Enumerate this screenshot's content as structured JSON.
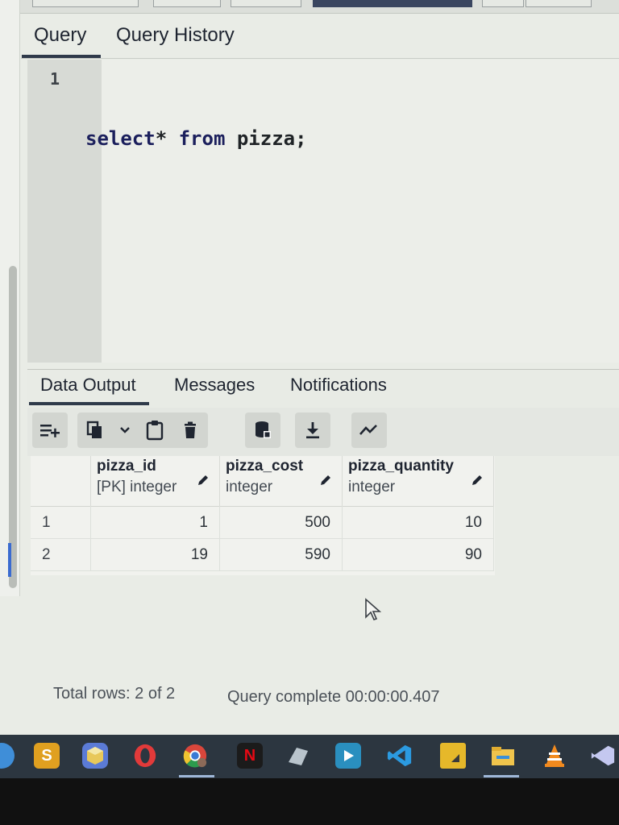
{
  "query_tabs": [
    {
      "label": "Query",
      "active": true
    },
    {
      "label": "Query History",
      "active": false
    }
  ],
  "editor": {
    "line_number": "1",
    "code": {
      "kw1": "select",
      "star": "*",
      "kw2": "from",
      "rest": " pizza;"
    }
  },
  "result_tabs": [
    {
      "label": "Data Output",
      "active": true
    },
    {
      "label": "Messages",
      "active": false
    },
    {
      "label": "Notifications",
      "active": false
    }
  ],
  "toolbar": {
    "icons": [
      "add-row-icon",
      "copy-icon",
      "chevron-down-icon",
      "paste-icon",
      "delete-icon",
      "save-data-icon",
      "download-icon",
      "graph-icon"
    ]
  },
  "grid": {
    "columns": [
      {
        "name": "pizza_id",
        "type": "[PK] integer"
      },
      {
        "name": "pizza_cost",
        "type": "integer"
      },
      {
        "name": "pizza_quantity",
        "type": "integer"
      }
    ],
    "rows": [
      {
        "num": "1",
        "cells": [
          "1",
          "500",
          "10"
        ]
      },
      {
        "num": "2",
        "cells": [
          "19",
          "590",
          "90"
        ]
      }
    ]
  },
  "status": {
    "total_rows": "Total rows: 2 of 2",
    "query_complete": "Query complete 00:00:00.407"
  },
  "taskbar": {
    "apps": [
      "sublime-text-icon",
      "box-app-icon",
      "opera-icon",
      "chrome-icon",
      "netflix-icon",
      "app-icon",
      "media-player-icon",
      "vscode-icon",
      "notes-icon",
      "file-explorer-icon",
      "vlc-icon",
      "visual-studio-icon"
    ]
  },
  "colors": {
    "accent": "#2f3a4a",
    "background": "#e9ece6",
    "taskbar": "#2c3640"
  }
}
